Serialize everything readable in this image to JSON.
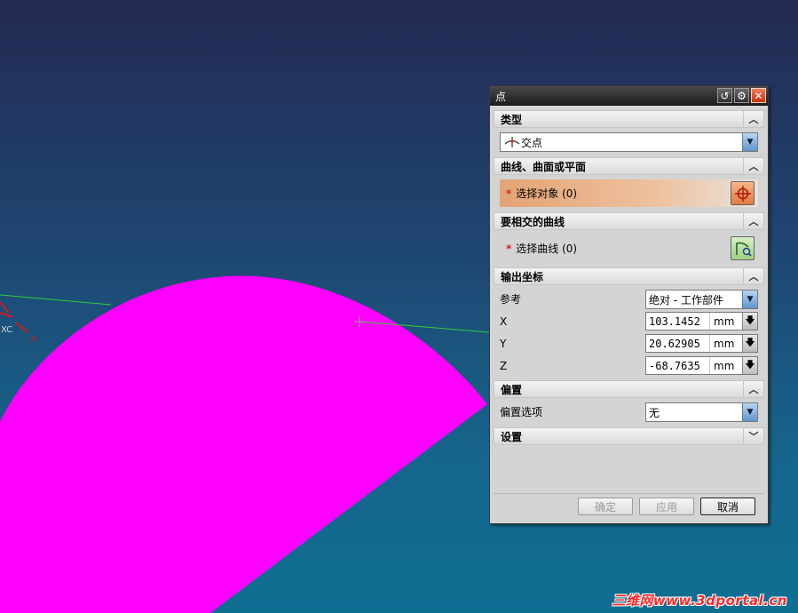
{
  "dialog": {
    "title": "点",
    "sections": {
      "type": {
        "header": "类型",
        "selected": "交点",
        "icon": "intersection-point-icon"
      },
      "curve_surface_plane": {
        "header": "曲线、曲面或平面",
        "select_label": "选择对象 (0)"
      },
      "intersect_curve": {
        "header": "要相交的曲线",
        "select_label": "选择曲线 (0)"
      },
      "output_coords": {
        "header": "输出坐标",
        "reference_label": "参考",
        "reference_value": "绝对 - 工作部件",
        "x_label": "X",
        "x_value": "103.1452",
        "y_label": "Y",
        "y_value": "20.62905",
        "z_label": "Z",
        "z_value": "-68.7635",
        "unit": "mm"
      },
      "offset": {
        "header": "偏置",
        "option_label": "偏置选项",
        "option_value": "无"
      },
      "settings": {
        "header": "设置"
      }
    },
    "buttons": {
      "ok": "确定",
      "apply": "应用",
      "cancel": "取消"
    }
  },
  "viewport": {
    "axis_xc": "XC",
    "axis_x": "X",
    "shape_color": "#ff00ff",
    "line_color": "#33cc33"
  },
  "watermark": "三维网www.3dportal.cn"
}
